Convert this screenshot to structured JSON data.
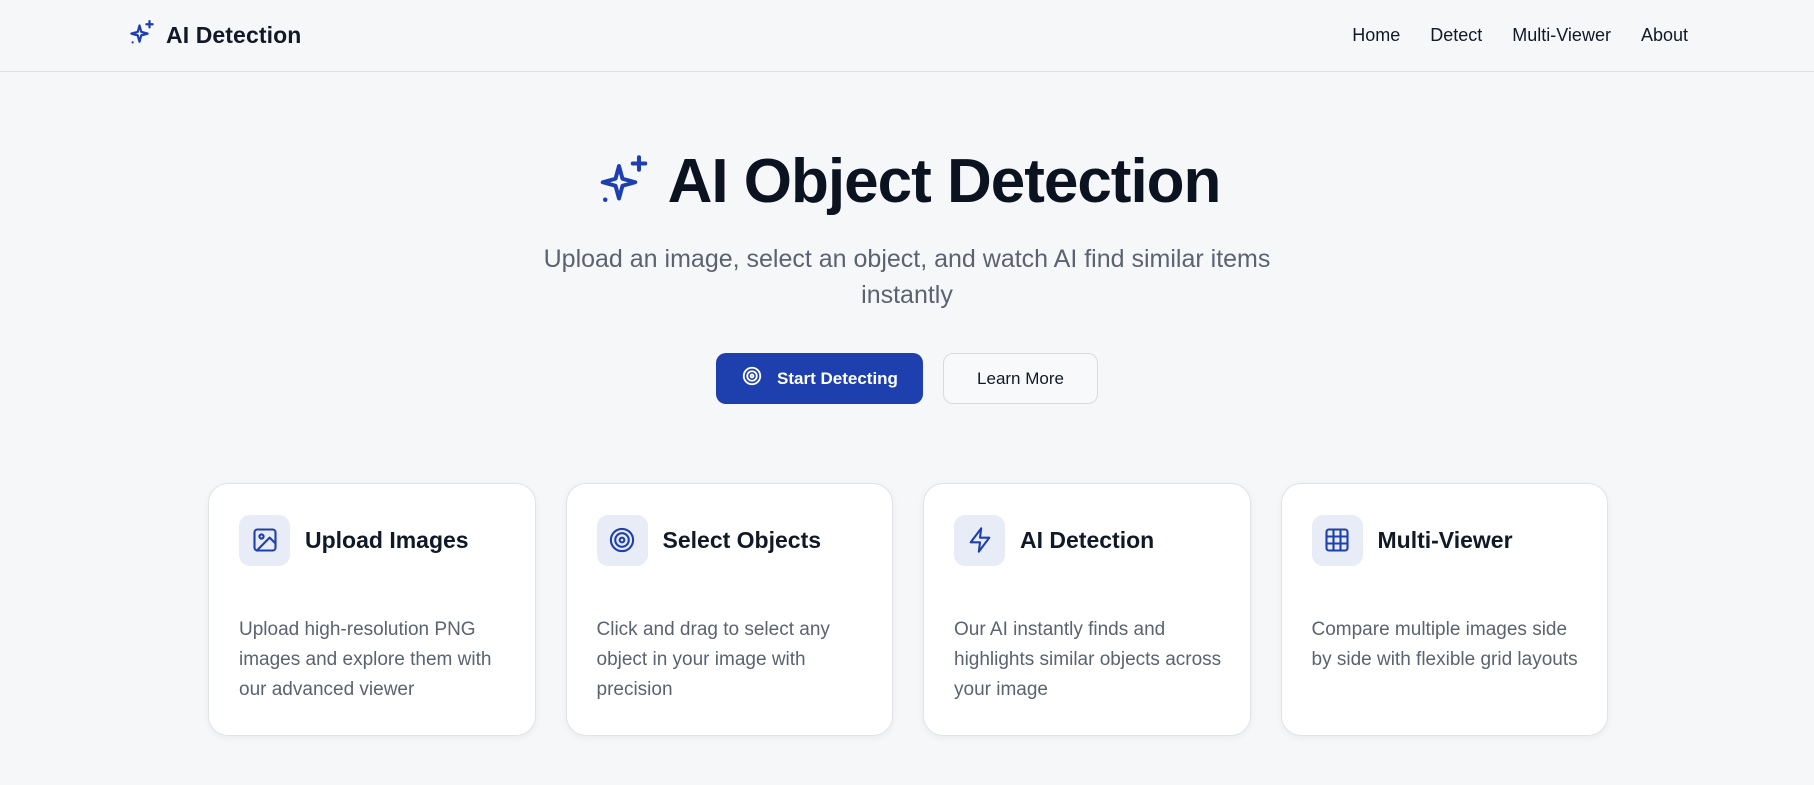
{
  "colors": {
    "accent": "#1e40af",
    "background": "#f6f7f9",
    "muted_text": "#5b6270",
    "icon_tile": "#e8ecf6"
  },
  "header": {
    "brand_icon": "sparkles-icon",
    "brand_title": "AI Detection",
    "nav": [
      {
        "label": "Home"
      },
      {
        "label": "Detect"
      },
      {
        "label": "Multi-Viewer"
      },
      {
        "label": "About"
      }
    ]
  },
  "hero": {
    "icon": "sparkles-icon",
    "title": "AI Object Detection",
    "subtitle": "Upload an image, select an object, and watch AI find similar items instantly",
    "primary_button": {
      "icon": "target-icon",
      "label": "Start Detecting"
    },
    "secondary_button": {
      "label": "Learn More"
    }
  },
  "features": [
    {
      "icon": "image-icon",
      "title": "Upload Images",
      "description": "Upload high-resolution PNG images and explore them with our advanced viewer"
    },
    {
      "icon": "target-icon",
      "title": "Select Objects",
      "description": "Click and drag to select any object in your image with precision"
    },
    {
      "icon": "lightning-icon",
      "title": "AI Detection",
      "description": "Our AI instantly finds and highlights similar objects across your image"
    },
    {
      "icon": "grid-icon",
      "title": "Multi-Viewer",
      "description": "Compare multiple images side by side with flexible grid layouts"
    }
  ]
}
